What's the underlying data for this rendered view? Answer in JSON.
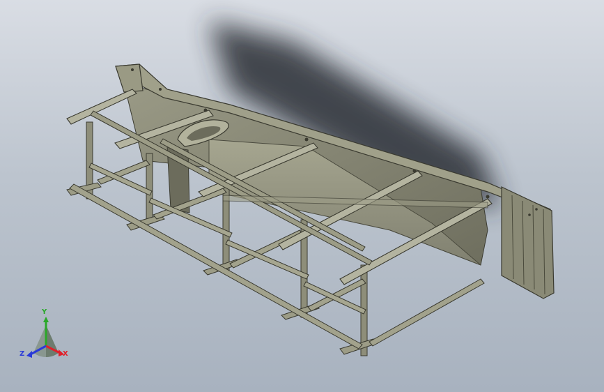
{
  "viewport": {
    "colors": {
      "background_top": "#d9dde4",
      "background_bottom": "#a8b2bf",
      "steel": "#8a8a78",
      "steel_dark": "#5a5a4c",
      "shadow": "#2a2e36"
    }
  },
  "triad": {
    "x_label": "X",
    "y_label": "Y",
    "z_label": "Z",
    "x_color": "#e0202a",
    "y_color": "#2aa82a",
    "z_color": "#2a3ad8"
  }
}
